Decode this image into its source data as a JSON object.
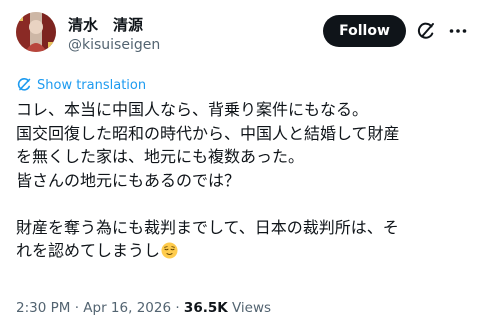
{
  "author": {
    "display_name": "清水　清源",
    "handle": "@kisuiseigen"
  },
  "header": {
    "follow_label": "Follow"
  },
  "translation": {
    "label": "Show translation"
  },
  "tweet": {
    "lines": [
      "コレ、本当に中国人なら、背乗り案件にもなる。",
      "国交回復した昭和の時代から、中国人と結婚して財産",
      "を無くした家は、地元にも複数あった。",
      "皆さんの地元にもあるのでは？",
      "",
      "財産を奪う為にも裁判までして、日本の裁判所は、そ",
      "れを認めてしまうし"
    ],
    "emoji": "relieved-face"
  },
  "meta": {
    "time": "2:30 PM",
    "separator": " · ",
    "date": "Apr 16, 2026",
    "views_count": "36.5K",
    "views_label": " Views"
  },
  "colors": {
    "accent": "#1d9bf0",
    "text_primary": "#0f1419",
    "text_secondary": "#536471",
    "button_bg": "#0f1419"
  }
}
